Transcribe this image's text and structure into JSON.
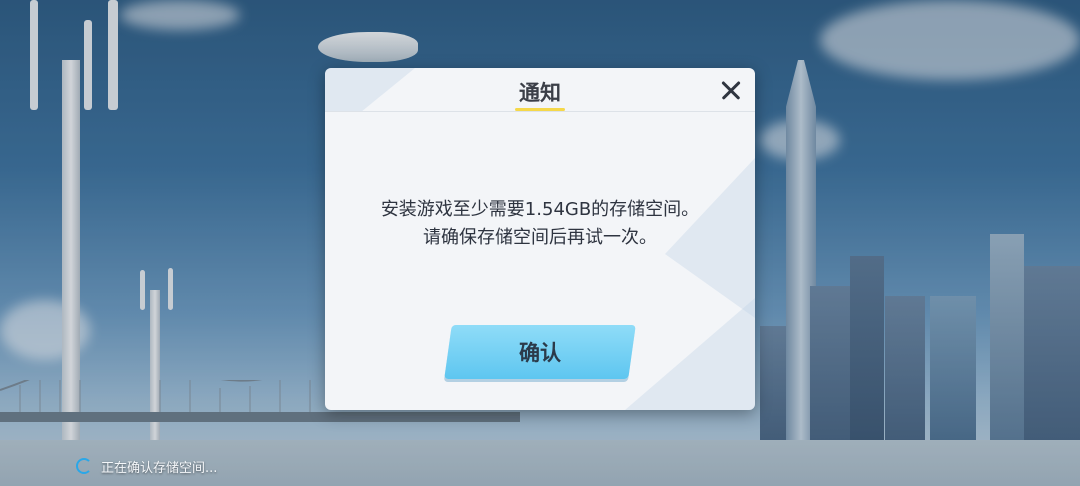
{
  "dialog": {
    "title": "通知",
    "message_lines": [
      "安装游戏至少需要1.54GB的存储空间。",
      "请确保存储空间后再试一次。"
    ],
    "confirm_label": "确认",
    "close_icon": "close-icon"
  },
  "status": {
    "text": "正在确认存储空间...",
    "icon": "loading-spinner-icon"
  },
  "colors": {
    "accent": "#5ec6f0",
    "title_underline": "#f5d84a",
    "dialog_bg": "#f3f5f8"
  }
}
